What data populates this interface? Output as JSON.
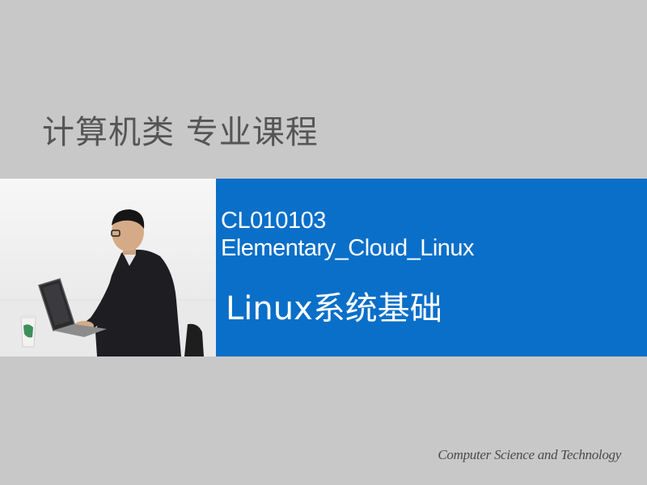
{
  "header": {
    "title": "计算机类  专业课程"
  },
  "course": {
    "code": "CL010103",
    "name": "Elementary_Cloud_Linux",
    "title": "Linux系统基础"
  },
  "footer": {
    "text": "Computer Science and Technology"
  },
  "colors": {
    "background": "#c8c8c8",
    "band_blue": "#0a6fc9",
    "title_gray": "#555555",
    "text_white": "#ffffff"
  },
  "photo": {
    "description_icon": "person-with-laptop-photo"
  }
}
